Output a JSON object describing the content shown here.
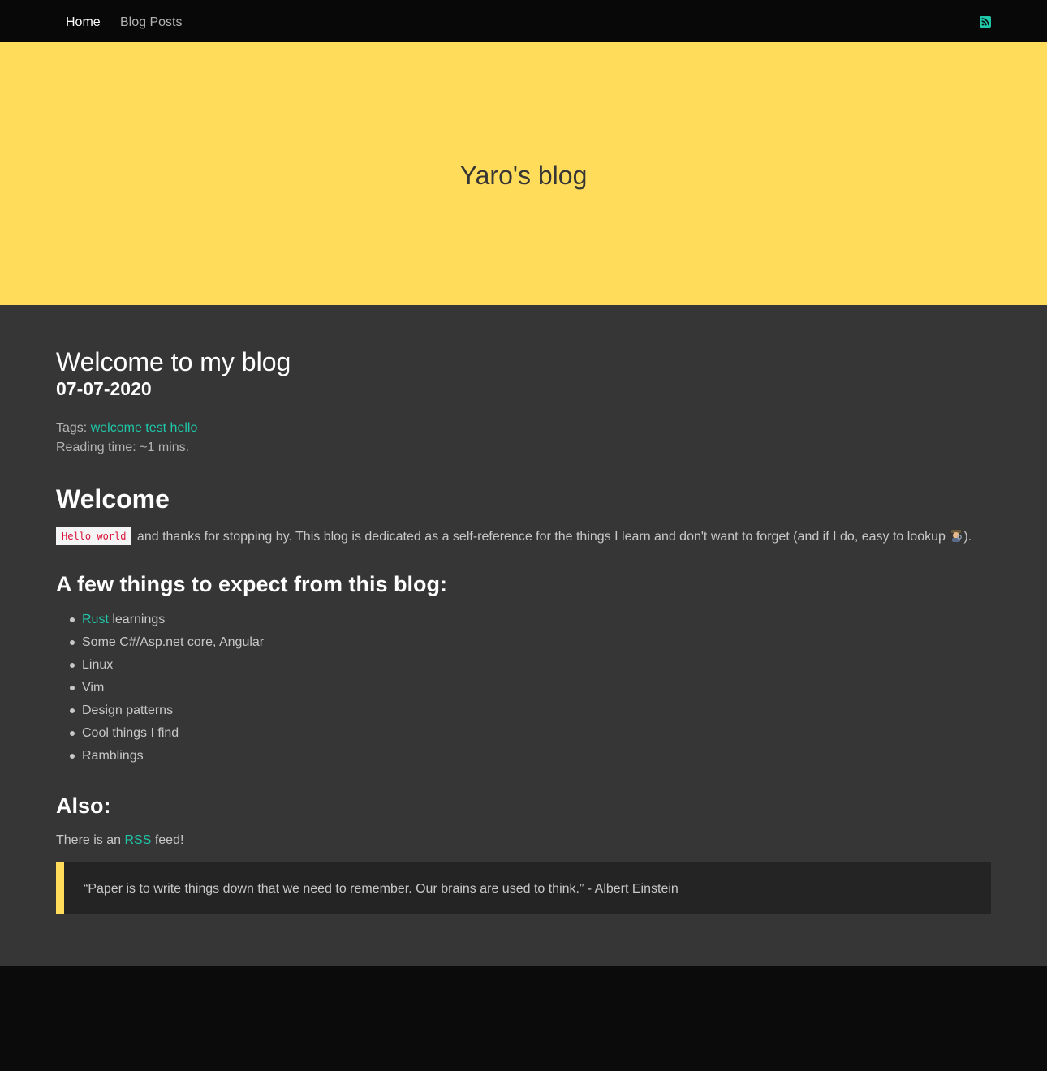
{
  "nav": {
    "home": "Home",
    "blog_posts": "Blog Posts",
    "rss_icon": "rss-icon"
  },
  "hero": {
    "title": "Yaro's blog"
  },
  "post": {
    "title": "Welcome to my blog",
    "date": "07-07-2020",
    "tags_label": "Tags:",
    "tags": [
      "welcome",
      "test",
      "hello"
    ],
    "reading_time": "Reading time: ~1 mins.",
    "welcome_heading": "Welcome",
    "code_snippet": "Hello world",
    "intro_text": " and thanks for stopping by. This blog is dedicated as a self-reference for the things I learn and don't want to forget (and if I do, easy to lookup ",
    "intro_end": ").",
    "expect_heading": "A few things to expect from this blog:",
    "expect_items": [
      {
        "link": "Rust",
        "text": " learnings"
      },
      {
        "text": "Some C#/Asp.net core, Angular"
      },
      {
        "text": "Linux"
      },
      {
        "text": "Vim"
      },
      {
        "text": "Design patterns"
      },
      {
        "text": "Cool things I find"
      },
      {
        "text": "Ramblings"
      }
    ],
    "also_heading": "Also:",
    "rss_prefix": "There is an ",
    "rss_link": "RSS",
    "rss_suffix": " feed!",
    "quote": "“Paper is to write things down that we need to remember. Our brains are used to think.” - Albert Einstein"
  },
  "colors": {
    "accent": "#1fc8a9",
    "hero_bg": "#ffdc5a",
    "content_bg": "#363636",
    "nav_bg": "#080808"
  }
}
